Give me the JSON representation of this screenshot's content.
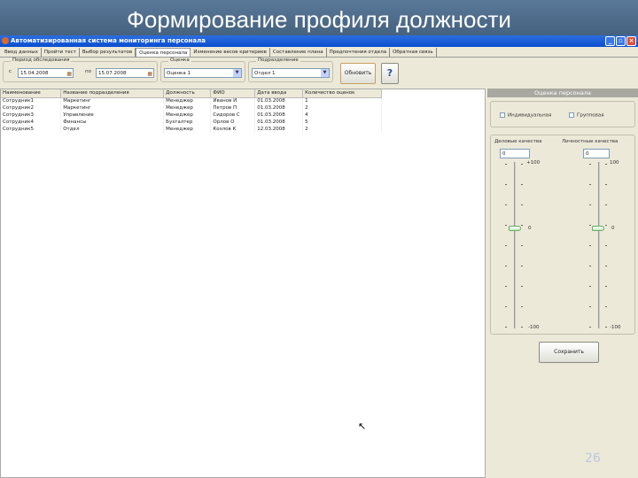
{
  "slide": {
    "title": "Формирование профиля должности",
    "page_number": "26"
  },
  "window": {
    "title": "Автоматизированная система мониторинга персонала"
  },
  "tabs": [
    "Ввод данных",
    "Пройти тест",
    "Выбор результатов",
    "Оценка персонала",
    "Изменение весов критериев",
    "Составление плана",
    "Предпочтения отдела",
    "Обратная связь"
  ],
  "filters": {
    "period_label": "Период обследования",
    "from_label": "с",
    "from_value": "15.04.2008",
    "to_label": "по",
    "to_value": "15.07.2008",
    "rating_label": "Оценка",
    "rating_value": "Оценка 1",
    "department_label": "Подразделение",
    "department_value": "Отдел 1",
    "refresh_label": "Обновить"
  },
  "table": {
    "columns": [
      "Наименование",
      "Название подразделения",
      "Должность",
      "ФИО",
      "Дата ввода",
      "Количество оценок"
    ],
    "rows": [
      [
        "Сотрудник1",
        "Маркетинг",
        "Менеджер",
        "Иванов И",
        "01.03.2008",
        "1"
      ],
      [
        "Сотрудник2",
        "Маркетинг",
        "Менеджер",
        "Петров П",
        "01.03.2008",
        "2"
      ],
      [
        "Сотрудник3",
        "Управление",
        "Менеджер",
        "Сидоров С",
        "01.03.2008",
        "4"
      ],
      [
        "Сотрудник4",
        "Финансы",
        "Бухгалтер",
        "Орлов О",
        "01.03.2008",
        "5"
      ],
      [
        "Сотрудник5",
        "Отдел",
        "Менеджер",
        "Козлов К",
        "12.03.2008",
        "2"
      ]
    ]
  },
  "panel": {
    "title": "Оценка персонала",
    "check1": "Индивидуальная",
    "check2": "Групповая",
    "slider1": {
      "label": "Деловые качества",
      "value": "0",
      "max": "+100",
      "mid": "0",
      "min": "-100"
    },
    "slider2": {
      "label": "Личностные качества",
      "value": "0",
      "max": "100",
      "mid": "0",
      "min": "-100"
    },
    "save_label": "Сохранить"
  }
}
